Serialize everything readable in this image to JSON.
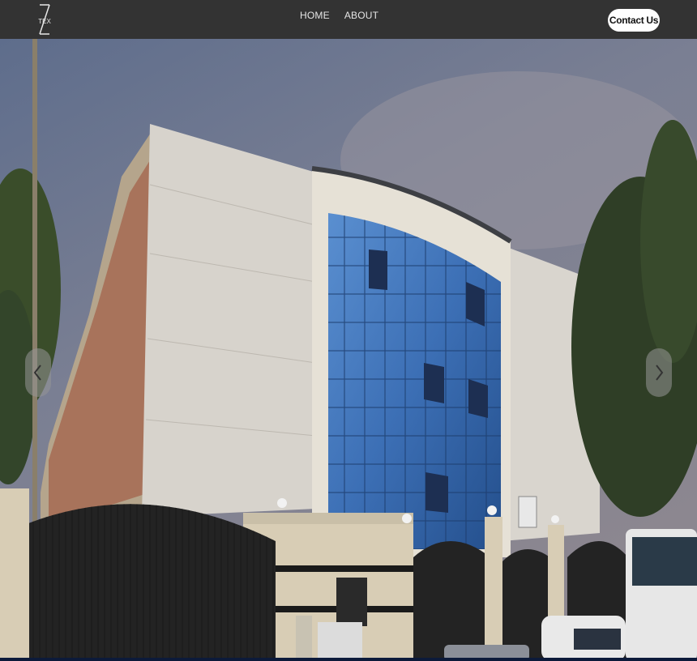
{
  "navbar": {
    "logo_text": "TEX",
    "links": [
      {
        "label": "HOME"
      },
      {
        "label": "ABOUT"
      }
    ],
    "contact_label": "Contact Us"
  },
  "hero": {
    "prev_icon": "chevron-left-icon",
    "next_icon": "chevron-right-icon"
  },
  "colors": {
    "navbar_bg": "#333333",
    "button_bg": "#ffffff",
    "arrow_bg": "#969696"
  }
}
